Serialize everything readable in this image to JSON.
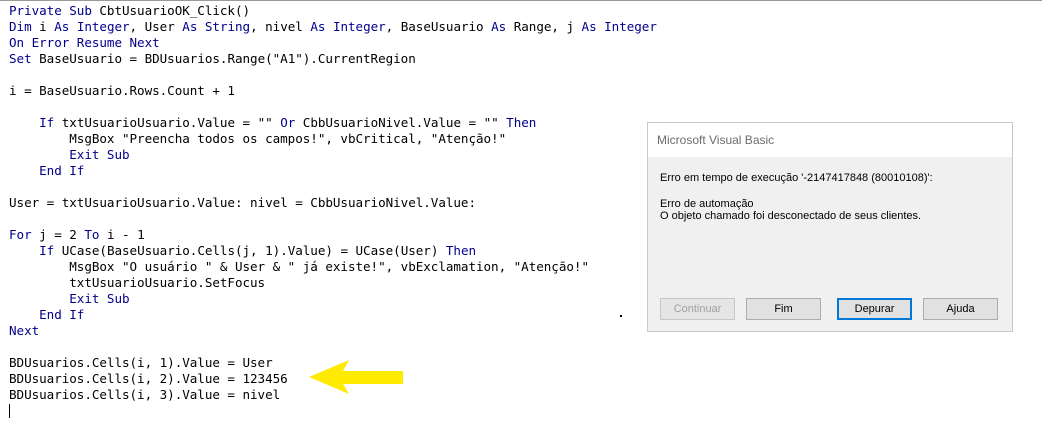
{
  "code": {
    "lines": [
      {
        "parts": [
          "",
          "Private Sub CbtUsuarioOK_Click()"
        ]
      },
      {
        "parts": [
          "",
          "Dim i As Integer, User As String, nivel As Integer, BaseUsuario As Range, j As Integer"
        ]
      },
      {
        "parts": [
          "On Error Resume Next",
          ""
        ]
      },
      {
        "parts": [
          "",
          "Set BaseUsuario = BDUsuarios.Range(\"A1\").CurrentRegion"
        ]
      },
      {
        "parts": [
          "",
          ""
        ]
      },
      {
        "parts": [
          "",
          "i = BaseUsuario.Rows.Count + 1"
        ]
      },
      {
        "parts": [
          "",
          ""
        ]
      },
      {
        "parts": [
          "",
          "    If txtUsuarioUsuario.Value = \"\" Or CbbUsuarioNivel.Value = \"\" Then"
        ]
      },
      {
        "parts": [
          "",
          "        MsgBox \"Preencha todos os campos!\", vbCritical, \"Atenção!\""
        ]
      },
      {
        "parts": [
          "",
          "        Exit Sub"
        ]
      },
      {
        "parts": [
          "",
          "    End If"
        ]
      },
      {
        "parts": [
          "",
          ""
        ]
      },
      {
        "parts": [
          "",
          "User = txtUsuarioUsuario.Value: nivel = CbbUsuarioNivel.Value:"
        ]
      },
      {
        "parts": [
          "",
          ""
        ]
      },
      {
        "parts": [
          "",
          "For j = 2 To i - 1"
        ]
      },
      {
        "parts": [
          "",
          "    If UCase(BaseUsuario.Cells(j, 1).Value) = UCase(User) Then"
        ]
      },
      {
        "parts": [
          "",
          "        MsgBox \"O usuário \" & User & \" já existe!\", vbExclamation, \"Atenção!\""
        ]
      },
      {
        "parts": [
          "",
          "        txtUsuarioUsuario.SetFocus"
        ]
      },
      {
        "parts": [
          "",
          "        Exit Sub"
        ]
      },
      {
        "parts": [
          "",
          "    End If"
        ]
      },
      {
        "parts": [
          "",
          "Next"
        ]
      },
      {
        "parts": [
          "",
          ""
        ]
      },
      {
        "parts": [
          "",
          "BDUsuarios.Cells(i, 1).Value = User"
        ]
      },
      {
        "parts": [
          "",
          "BDUsuarios.Cells(i, 2).Value = 123456"
        ]
      },
      {
        "parts": [
          "",
          "BDUsuarios.Cells(i, 3).Value = nivel"
        ]
      }
    ]
  },
  "highlight_arrow": {
    "icon": "left-arrow-icon",
    "color": "#ffeb00"
  },
  "dialog": {
    "title": "Microsoft Visual Basic",
    "error_line": "Erro em tempo de execução '-2147417848 (80010108)':",
    "error_type": "Erro de automação",
    "error_detail": "O objeto chamado foi desconectado de seus clientes.",
    "buttons": {
      "continue": "Continuar",
      "end": "Fim",
      "debug": "Depurar",
      "help": "Ajuda"
    }
  }
}
